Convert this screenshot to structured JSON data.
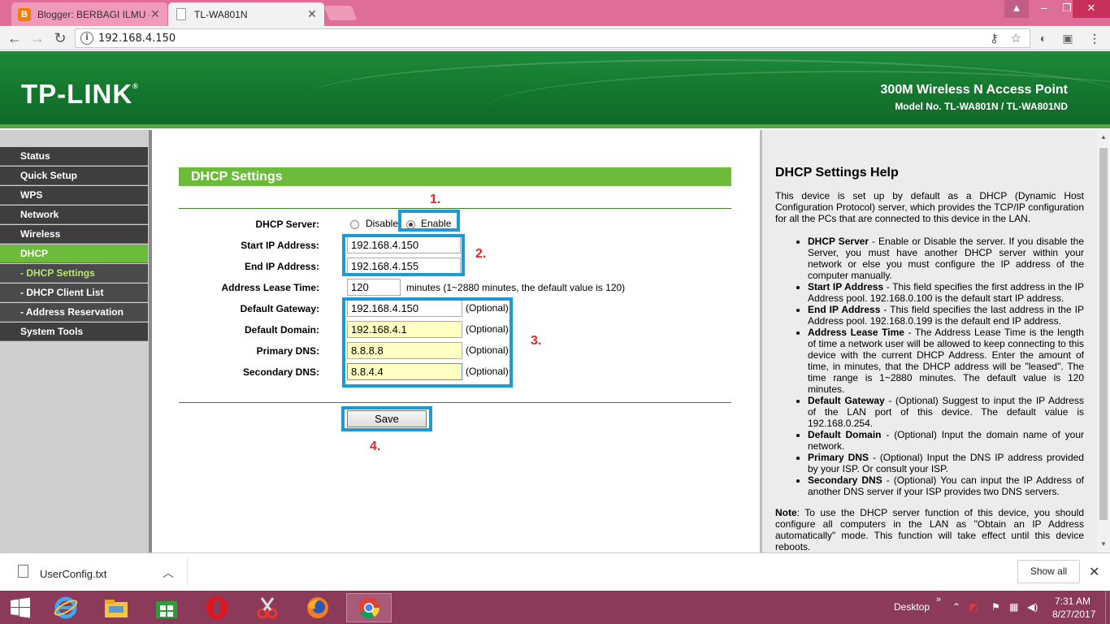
{
  "browser": {
    "tabs": [
      {
        "title": "Blogger: BERBAGI ILMU -",
        "active": false
      },
      {
        "title": "TL-WA801N",
        "active": true
      }
    ],
    "url": "192.168.4.150"
  },
  "header": {
    "logo": "TP-LINK",
    "logo_mark": "®",
    "product": "300M Wireless N Access Point",
    "model": "Model No. TL-WA801N / TL-WA801ND"
  },
  "menu": {
    "items": [
      {
        "label": "Status"
      },
      {
        "label": "Quick Setup"
      },
      {
        "label": "WPS"
      },
      {
        "label": "Network"
      },
      {
        "label": "Wireless"
      },
      {
        "label": "DHCP"
      },
      {
        "label": "- DHCP Settings"
      },
      {
        "label": "- DHCP Client List"
      },
      {
        "label": "- Address Reservation"
      },
      {
        "label": "System Tools"
      }
    ]
  },
  "form": {
    "title": "DHCP Settings",
    "dhcp_server_label": "DHCP Server:",
    "disable_label": "Disable",
    "enable_label": "Enable",
    "dhcp_server_value": "Enable",
    "start_ip_label": "Start IP Address:",
    "start_ip_value": "192.168.4.150",
    "end_ip_label": "End IP Address:",
    "end_ip_value": "192.168.4.155",
    "lease_label": "Address Lease Time:",
    "lease_value": "120",
    "lease_hint": "minutes (1~2880 minutes, the default value is 120)",
    "gateway_label": "Default Gateway:",
    "gateway_value": "192.168.4.150",
    "domain_label": "Default Domain:",
    "domain_value": "192.168.4.1",
    "primary_dns_label": "Primary DNS:",
    "primary_dns_value": "8.8.8.8",
    "secondary_dns_label": "Secondary DNS:",
    "secondary_dns_value": "8.8.4.4",
    "optional": "(Optional)",
    "save_label": "Save"
  },
  "annotations": {
    "n1": "1.",
    "n2": "2.",
    "n3": "3.",
    "n4": "4.",
    "color": "#1d9ad6",
    "number_color": "#e0282b"
  },
  "help": {
    "title": "DHCP Settings Help",
    "intro": "This device is set up by default as a DHCP (Dynamic Host Configuration Protocol) server, which provides the TCP/IP configuration for all the PCs that are connected to this device in the LAN.",
    "items": [
      {
        "term": "DHCP Server",
        "text": "- Enable or Disable the server. If you disable the Server, you must have another DHCP server within your network or else you must configure the IP address of the computer manually."
      },
      {
        "term": "Start IP Address",
        "text": "- This field specifies the first address in the IP Address pool. 192.168.0.100 is the default start IP address."
      },
      {
        "term": "End IP Address",
        "text": "- This field specifies the last address in the IP Address pool. 192.168.0.199 is the default end IP address."
      },
      {
        "term": "Address Lease Time",
        "text": "- The Address Lease Time is the length of time a network user will be allowed to keep connecting to this device with the current DHCP Address. Enter the amount of time, in minutes, that the DHCP address will be \"leased\". The time range is 1~2880 minutes. The default value is 120 minutes."
      },
      {
        "term": "Default Gateway",
        "text": "- (Optional) Suggest to input the IP Address of the LAN port of this device. The default value is 192.168.0.254."
      },
      {
        "term": "Default Domain",
        "text": "- (Optional) Input the domain name of your network."
      },
      {
        "term": "Primary DNS",
        "text": "- (Optional) Input the DNS IP address provided by your ISP. Or consult your ISP."
      },
      {
        "term": "Secondary DNS",
        "text": "- (Optional) You can input the IP Address of another DNS server if your ISP provides two DNS servers."
      }
    ],
    "note_label": "Note",
    "note_text": ": To use the DHCP server function of this device, you should configure all computers in the LAN as \"Obtain an IP Address automatically\" mode. This function will take effect until this device reboots."
  },
  "download": {
    "filename": "UserConfig.txt",
    "show_all": "Show all"
  },
  "taskbar": {
    "desktop_label": "Desktop",
    "time": "7:31 AM",
    "date": "8/27/2017"
  },
  "colors": {
    "brand_green": "#157a2f",
    "menu_active": "#6dbb3b",
    "tab_strip": "#de6e98",
    "taskbar": "#8b3a5a"
  }
}
